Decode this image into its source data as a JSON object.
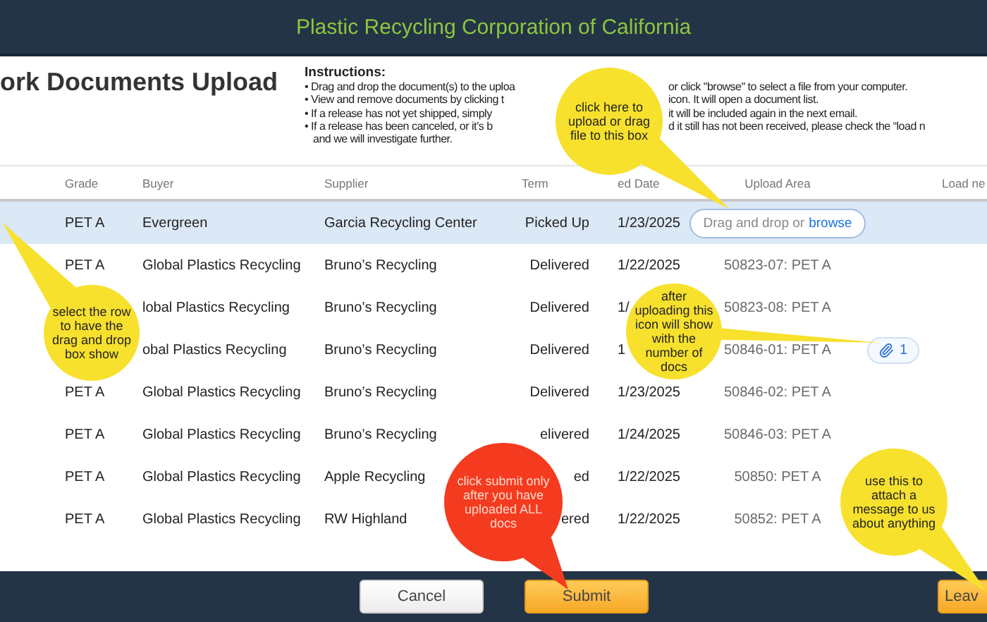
{
  "app_bar": {
    "title": "Plastic Recycling Corporation of California"
  },
  "page_title": "ork Documents Upload",
  "instructions": {
    "heading": "Instructions:",
    "lines": [
      {
        "left": "• Drag and drop the document(s) to the uploa",
        "right": "or click \"browse\" to select a file from your computer."
      },
      {
        "left": "• View and remove documents by clicking t",
        "right": "icon. It will open a document list."
      },
      {
        "left": "• If a release has not yet shipped, simply",
        "right": "it will be included again in the next email."
      },
      {
        "left": "• If a release has been canceled, or it’s b",
        "right": "d it still has not been received, please check the “load n"
      },
      {
        "left": "and we will investigate further."
      }
    ]
  },
  "table": {
    "columns": [
      "Grade",
      "Buyer",
      "Supplier",
      "Term",
      "ed Date",
      "Upload Area",
      "Load ne"
    ],
    "rows": [
      {
        "selected": true,
        "grade": "PET A",
        "buyer": "Evergreen",
        "supplier": "Garcia Recycling Center",
        "term": "Picked Up",
        "date": "1/23/2025",
        "drop_zone": {
          "text": "Drag and drop or",
          "link": "browse"
        }
      },
      {
        "selected": false,
        "grade": "PET A",
        "buyer": "Global Plastics Recycling",
        "supplier": "Bruno’s Recycling",
        "term": "Delivered",
        "date": "1/22/2025",
        "upload_area": "50823-07: PET A"
      },
      {
        "selected": false,
        "buyer": "lobal Plastics Recycling",
        "supplier": "Bruno’s Recycling",
        "term": "Delivered",
        "date": "1/",
        "upload_area": "50823-08: PET A"
      },
      {
        "selected": false,
        "buyer": "obal Plastics Recycling",
        "supplier": "Bruno’s Recycling",
        "term": "Delivered",
        "date": "1",
        "upload_area": "50846-01: PET A",
        "attachments": "1"
      },
      {
        "selected": false,
        "grade": "PET A",
        "buyer": "Global Plastics Recycling",
        "supplier": "Bruno’s Recycling",
        "term": "Delivered",
        "date": "1/23/2025",
        "upload_area": "50846-02: PET A"
      },
      {
        "selected": false,
        "grade": "PET A",
        "buyer": "Global Plastics Recycling",
        "supplier": "Bruno’s Recycling",
        "term": "elivered",
        "date": "1/24/2025",
        "upload_area": "50846-03: PET A"
      },
      {
        "selected": false,
        "grade": "PET A",
        "buyer": "Global Plastics Recycling",
        "supplier": "Apple Recycling",
        "term": "ed",
        "date": "1/22/2025",
        "upload_area": "50850: PET A"
      },
      {
        "selected": false,
        "grade": "PET A",
        "buyer": "Global Plastics Recycling",
        "supplier": "RW Highland",
        "term": "ered",
        "date": "1/22/2025",
        "upload_area": "50852: PET A"
      }
    ]
  },
  "footer": {
    "buttons": [
      {
        "label": "Cancel",
        "kind": "secondary"
      },
      {
        "label": "Submit",
        "kind": "primary"
      },
      {
        "label": "Leav",
        "kind": "primary"
      }
    ]
  },
  "callouts": [
    {
      "text": "click here to upload or drag file to this box",
      "color": "#f7e12d"
    },
    {
      "text": "select the row to have the drag and drop box show",
      "color": "#f7e12d"
    },
    {
      "text": "after uploading this icon will show with the number of docs",
      "color": "#f7e12d"
    },
    {
      "text": "click submit only after you have uploaded ALL docs",
      "color": "#f43b1f"
    },
    {
      "text": "use this to attach a message to us about anything",
      "color": "#f7e12d"
    }
  ]
}
